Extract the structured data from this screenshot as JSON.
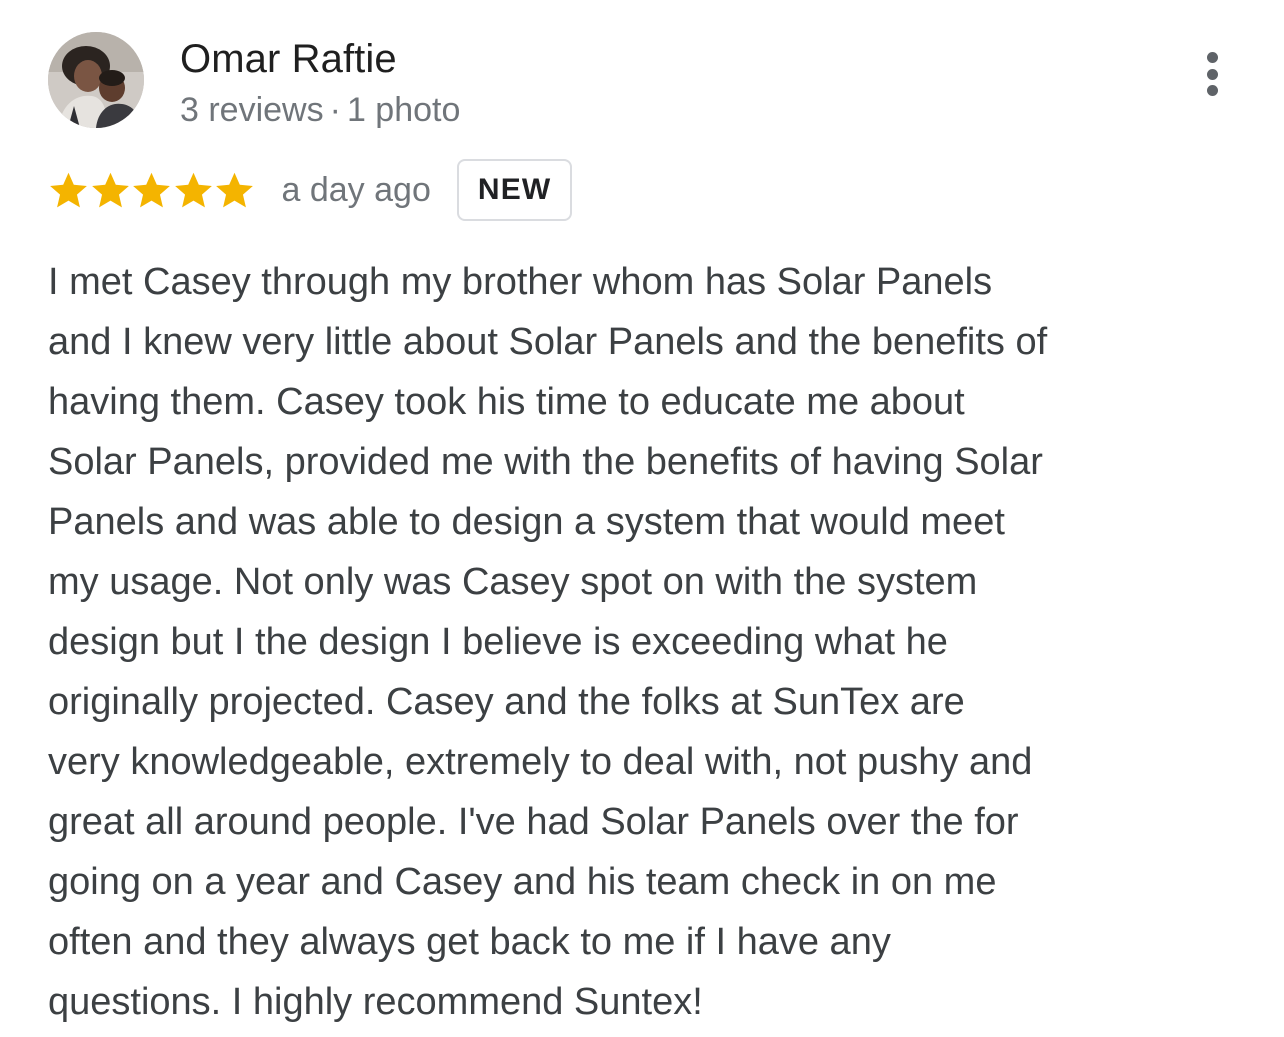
{
  "review": {
    "author": {
      "name": "Omar Raftie",
      "reviews": "3 reviews",
      "separator": "·",
      "photos": "1 photo",
      "avatar_icon": "user-photo-avatar"
    },
    "more_options_icon": "vertical-ellipsis-icon",
    "rating": {
      "value": 5,
      "max": 5,
      "star_color": "#F4B400"
    },
    "date": "a day ago",
    "badge": "NEW",
    "text": "I met Casey through my brother whom has Solar Panels\nand I knew very little about Solar Panels and the benefits of\nhaving them.  Casey took his time to educate me about\nSolar Panels, provided me with the benefits of having Solar\nPanels and was able to design a system that would meet\nmy usage.  Not only was Casey spot on with the system\ndesign but I the design I believe is exceeding what he\noriginally projected.  Casey and the folks at SunTex are\nvery knowledgeable, extremely to deal with, not pushy and\ngreat all around people.  I've had Solar Panels over the for\ngoing on a year and Casey and his team check in on me\noften and they always get back to me if I have any\nquestions. I highly recommend Suntex!"
  }
}
